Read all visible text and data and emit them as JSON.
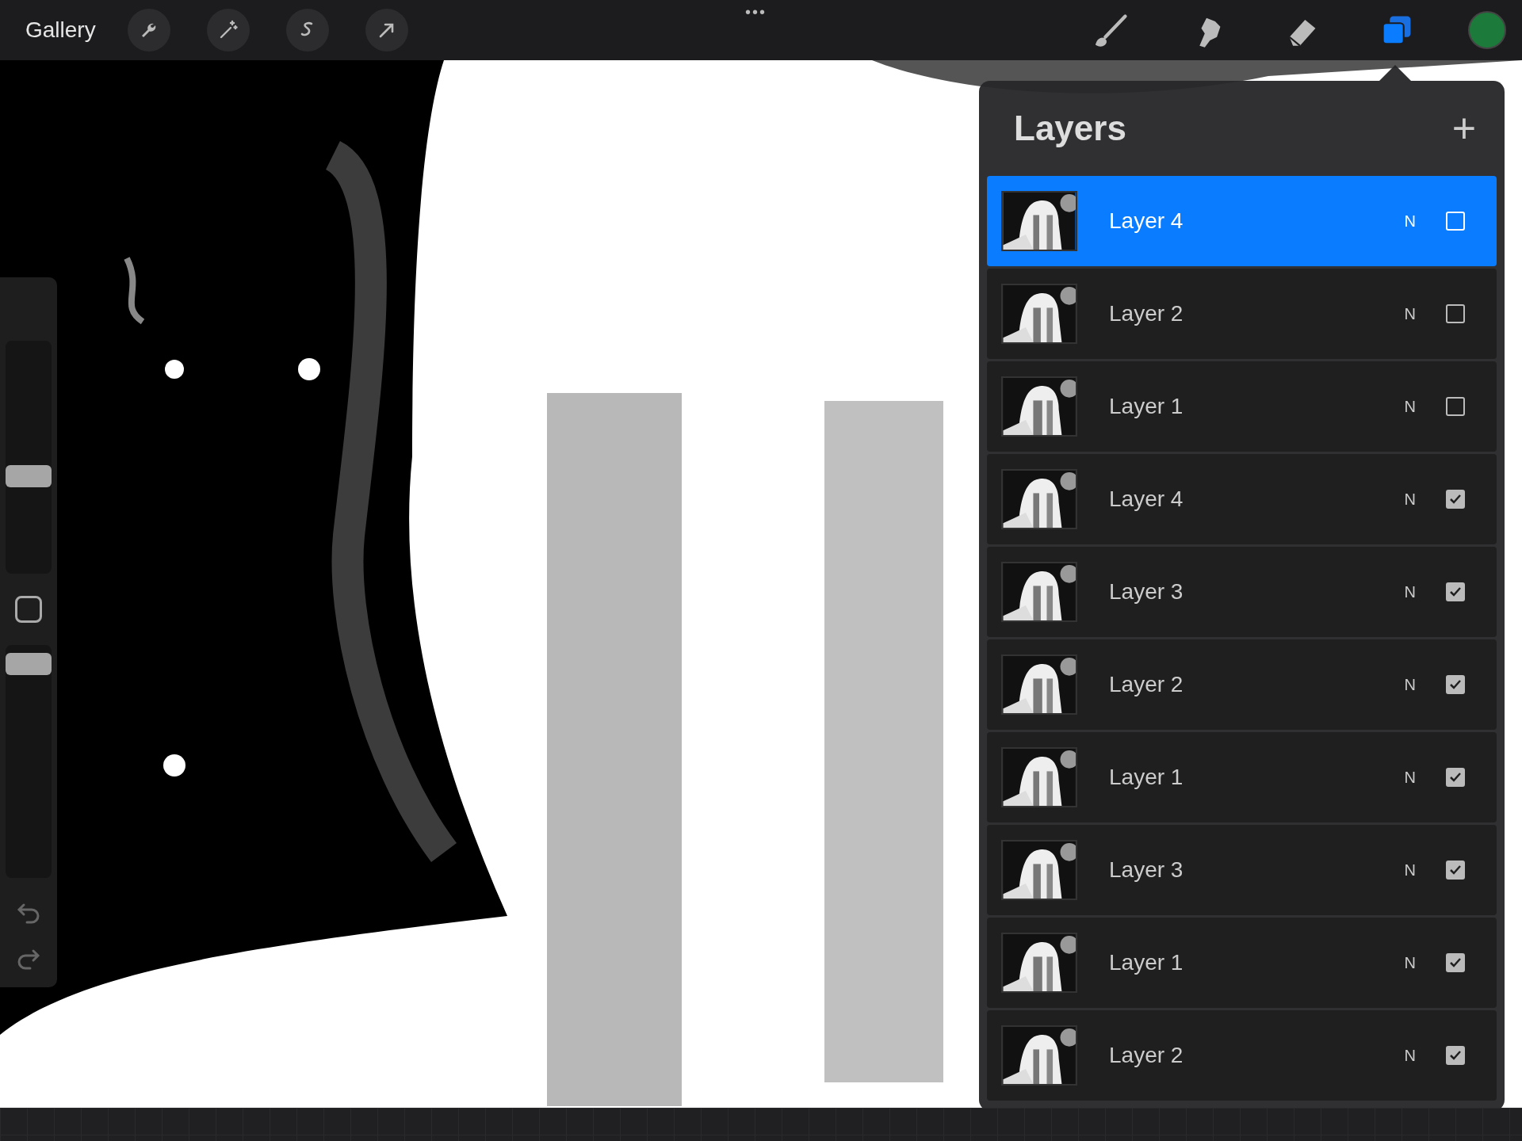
{
  "toolbar": {
    "gallery": "Gallery",
    "more": "•••",
    "tools": [
      {
        "kind": "wrench"
      },
      {
        "kind": "wand"
      },
      {
        "kind": "selection"
      },
      {
        "kind": "arrow"
      }
    ],
    "brushes": [
      {
        "kind": "brush",
        "selected": false
      },
      {
        "kind": "smudge",
        "selected": false
      },
      {
        "kind": "eraser",
        "selected": false
      },
      {
        "kind": "layers",
        "selected": true
      }
    ],
    "color": "#1c7a3a"
  },
  "sidebar": {
    "size_slider": {
      "level": 0.42
    },
    "opacity_slider": {
      "level": 0.92
    }
  },
  "layers_panel": {
    "title": "Layers",
    "add": "+",
    "layers": [
      {
        "name": "Layer 4",
        "blend": "N",
        "visible": false,
        "selected": true
      },
      {
        "name": "Layer 2",
        "blend": "N",
        "visible": false,
        "selected": false
      },
      {
        "name": "Layer 1",
        "blend": "N",
        "visible": false,
        "selected": false
      },
      {
        "name": "Layer 4",
        "blend": "N",
        "visible": true,
        "selected": false
      },
      {
        "name": "Layer 3",
        "blend": "N",
        "visible": true,
        "selected": false
      },
      {
        "name": "Layer 2",
        "blend": "N",
        "visible": true,
        "selected": false
      },
      {
        "name": "Layer 1",
        "blend": "N",
        "visible": true,
        "selected": false
      },
      {
        "name": "Layer 3",
        "blend": "N",
        "visible": true,
        "selected": false
      },
      {
        "name": "Layer 1",
        "blend": "N",
        "visible": true,
        "selected": false
      },
      {
        "name": "Layer 2",
        "blend": "N",
        "visible": true,
        "selected": false
      }
    ]
  }
}
